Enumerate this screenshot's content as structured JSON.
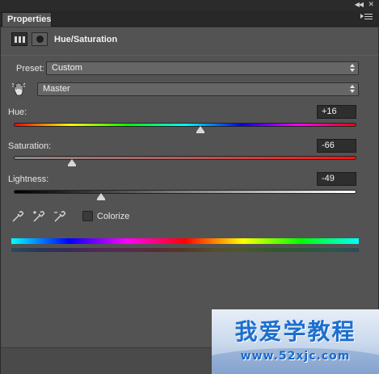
{
  "panel": {
    "tab_label": "Properties",
    "title": "Hue/Saturation"
  },
  "preset": {
    "label": "Preset:",
    "value": "Custom"
  },
  "channel": {
    "value": "Master"
  },
  "hue": {
    "label": "Hue:",
    "value": "+16",
    "min": -180,
    "max": 180,
    "level": 16
  },
  "saturation": {
    "label": "Saturation:",
    "value": "-66",
    "min": -100,
    "max": 100,
    "level": -66
  },
  "lightness": {
    "label": "Lightness:",
    "value": "-49",
    "min": -100,
    "max": 100,
    "level": -49
  },
  "colorize": {
    "label": "Colorize",
    "checked": false
  },
  "icons": {
    "adjustment": "hue-saturation-adjustment-icon",
    "mask": "layer-mask-icon",
    "targeted_adjustment": "hand-adjust-icon",
    "eyedropper": "eyedropper-icon",
    "eyedropper_add": "eyedropper-plus-icon",
    "eyedropper_subtract": "eyedropper-minus-icon"
  },
  "watermark": {
    "title": "我爱学教程",
    "url": "www.52xjc.com"
  }
}
